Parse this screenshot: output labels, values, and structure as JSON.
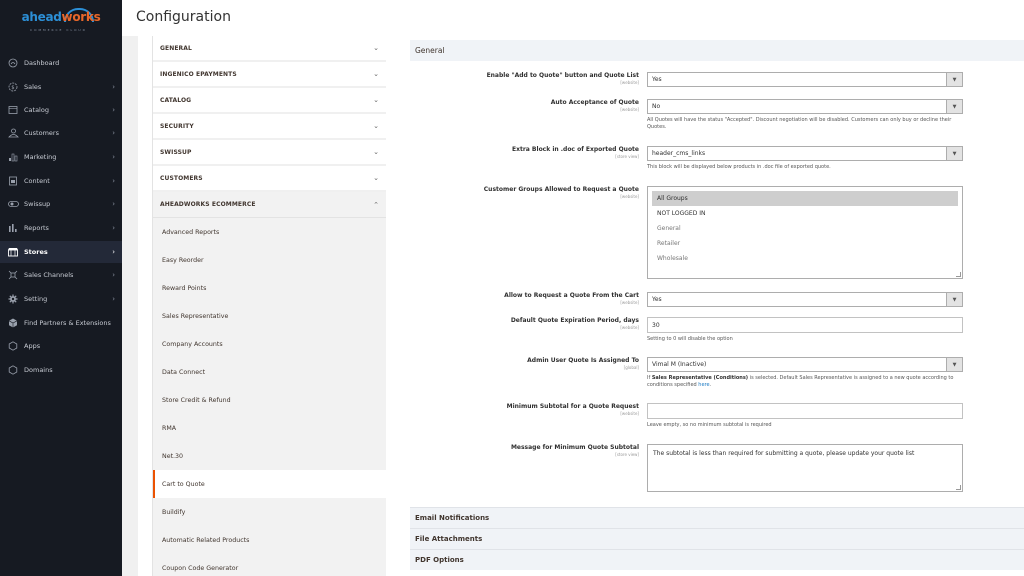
{
  "logo": {
    "part1": "ahead",
    "part2": "works",
    "tagline": "COMMERCE CLOUD"
  },
  "nav": [
    {
      "label": "Dashboard",
      "icon": "dashboard-icon",
      "chevron": false
    },
    {
      "label": "Sales",
      "icon": "sales-icon",
      "chevron": true
    },
    {
      "label": "Catalog",
      "icon": "catalog-icon",
      "chevron": true
    },
    {
      "label": "Customers",
      "icon": "customers-icon",
      "chevron": true
    },
    {
      "label": "Marketing",
      "icon": "marketing-icon",
      "chevron": true
    },
    {
      "label": "Content",
      "icon": "content-icon",
      "chevron": true
    },
    {
      "label": "Swissup",
      "icon": "swissup-icon",
      "chevron": true
    },
    {
      "label": "Reports",
      "icon": "reports-icon",
      "chevron": true
    },
    {
      "label": "Stores",
      "icon": "stores-icon",
      "chevron": true,
      "active": true
    },
    {
      "label": "Sales Channels",
      "icon": "sales-channels-icon",
      "chevron": true
    },
    {
      "label": "Setting",
      "icon": "gear-icon",
      "chevron": true
    },
    {
      "label": "Find Partners & Extensions",
      "icon": "extensions-icon",
      "chevron": false
    },
    {
      "label": "Apps",
      "icon": "hexagon-icon",
      "chevron": false
    },
    {
      "label": "Domains",
      "icon": "hexagon-icon",
      "chevron": false
    }
  ],
  "page_title": "Configuration",
  "config_tabs": [
    {
      "label": "GENERAL"
    },
    {
      "label": "INGENICO EPAYMENTS"
    },
    {
      "label": "CATALOG"
    },
    {
      "label": "SECURITY"
    },
    {
      "label": "SWISSUP"
    },
    {
      "label": "CUSTOMERS"
    },
    {
      "label": "AHEADWORKS ECOMMERCE",
      "open": true
    }
  ],
  "sub_tabs": [
    "Advanced Reports",
    "Easy Reorder",
    "Reward Points",
    "Sales Representative",
    "Company Accounts",
    "Data Connect",
    "Store Credit & Refund",
    "RMA",
    "Net.30",
    "Cart to Quote",
    "Buildify",
    "Automatic Related Products",
    "Coupon Code Generator"
  ],
  "active_sub_tab": "Cart to Quote",
  "section": {
    "title": "General",
    "fields": {
      "enable": {
        "label": "Enable \"Add to Quote\" button and Quote List",
        "scope": "[website]",
        "value": "Yes"
      },
      "auto_accept": {
        "label": "Auto Acceptance of Quote",
        "scope": "[website]",
        "value": "No",
        "note": "All Quotes will have the status \"Accepted\". Discount negotiation will be disabled. Customers can only buy or decline their Quotes."
      },
      "extra_block": {
        "label": "Extra Block in .doc of Exported Quote",
        "scope": "[store view]",
        "value": "header_cms_links",
        "note": "This block will be displayed below products in .doc file of exported quote."
      },
      "customer_groups": {
        "label": "Customer Groups Allowed to Request a Quote",
        "scope": "[website]",
        "options": [
          "All Groups",
          "NOT LOGGED IN",
          "General",
          "Retailer",
          "Wholesale"
        ],
        "selected": "All Groups"
      },
      "from_cart": {
        "label": "Allow to Request a Quote From the Cart",
        "scope": "[website]",
        "value": "Yes"
      },
      "expiration": {
        "label": "Default Quote Expiration Period, days",
        "scope": "[website]",
        "value": "30",
        "note": "Setting to 0 will disable the option"
      },
      "admin_user": {
        "label": "Admin User Quote Is Assigned To",
        "scope": "[global]",
        "value": "Vimal M (Inactive)",
        "note_prefix": "If ",
        "note_bold": "Sales Representative (Conditions)",
        "note_mid": " is selected. Default Sales Representative is assigned to a new quote according to conditions specified ",
        "note_link": "here",
        "note_end": "."
      },
      "min_subtotal": {
        "label": "Minimum Subtotal for a Quote Request",
        "scope": "[website]",
        "value": "",
        "note": "Leave empty, so no minimum subtotal is required"
      },
      "min_message": {
        "label": "Message for Minimum Quote Subtotal",
        "scope": "[store view]",
        "value": "The subtotal is less than required for submitting a quote, please update your quote list"
      }
    }
  },
  "collapsed_sections": [
    "Email Notifications",
    "File Attachments",
    "PDF Options"
  ]
}
